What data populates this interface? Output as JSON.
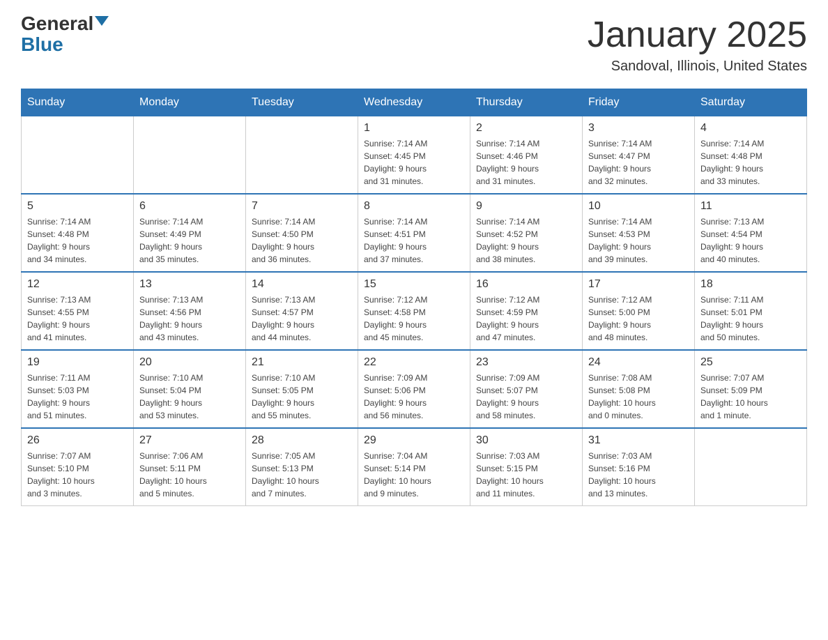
{
  "header": {
    "logo_general": "General",
    "logo_blue": "Blue",
    "title": "January 2025",
    "location": "Sandoval, Illinois, United States"
  },
  "days_of_week": [
    "Sunday",
    "Monday",
    "Tuesday",
    "Wednesday",
    "Thursday",
    "Friday",
    "Saturday"
  ],
  "weeks": [
    [
      {
        "day": "",
        "info": ""
      },
      {
        "day": "",
        "info": ""
      },
      {
        "day": "",
        "info": ""
      },
      {
        "day": "1",
        "info": "Sunrise: 7:14 AM\nSunset: 4:45 PM\nDaylight: 9 hours\nand 31 minutes."
      },
      {
        "day": "2",
        "info": "Sunrise: 7:14 AM\nSunset: 4:46 PM\nDaylight: 9 hours\nand 31 minutes."
      },
      {
        "day": "3",
        "info": "Sunrise: 7:14 AM\nSunset: 4:47 PM\nDaylight: 9 hours\nand 32 minutes."
      },
      {
        "day": "4",
        "info": "Sunrise: 7:14 AM\nSunset: 4:48 PM\nDaylight: 9 hours\nand 33 minutes."
      }
    ],
    [
      {
        "day": "5",
        "info": "Sunrise: 7:14 AM\nSunset: 4:48 PM\nDaylight: 9 hours\nand 34 minutes."
      },
      {
        "day": "6",
        "info": "Sunrise: 7:14 AM\nSunset: 4:49 PM\nDaylight: 9 hours\nand 35 minutes."
      },
      {
        "day": "7",
        "info": "Sunrise: 7:14 AM\nSunset: 4:50 PM\nDaylight: 9 hours\nand 36 minutes."
      },
      {
        "day": "8",
        "info": "Sunrise: 7:14 AM\nSunset: 4:51 PM\nDaylight: 9 hours\nand 37 minutes."
      },
      {
        "day": "9",
        "info": "Sunrise: 7:14 AM\nSunset: 4:52 PM\nDaylight: 9 hours\nand 38 minutes."
      },
      {
        "day": "10",
        "info": "Sunrise: 7:14 AM\nSunset: 4:53 PM\nDaylight: 9 hours\nand 39 minutes."
      },
      {
        "day": "11",
        "info": "Sunrise: 7:13 AM\nSunset: 4:54 PM\nDaylight: 9 hours\nand 40 minutes."
      }
    ],
    [
      {
        "day": "12",
        "info": "Sunrise: 7:13 AM\nSunset: 4:55 PM\nDaylight: 9 hours\nand 41 minutes."
      },
      {
        "day": "13",
        "info": "Sunrise: 7:13 AM\nSunset: 4:56 PM\nDaylight: 9 hours\nand 43 minutes."
      },
      {
        "day": "14",
        "info": "Sunrise: 7:13 AM\nSunset: 4:57 PM\nDaylight: 9 hours\nand 44 minutes."
      },
      {
        "day": "15",
        "info": "Sunrise: 7:12 AM\nSunset: 4:58 PM\nDaylight: 9 hours\nand 45 minutes."
      },
      {
        "day": "16",
        "info": "Sunrise: 7:12 AM\nSunset: 4:59 PM\nDaylight: 9 hours\nand 47 minutes."
      },
      {
        "day": "17",
        "info": "Sunrise: 7:12 AM\nSunset: 5:00 PM\nDaylight: 9 hours\nand 48 minutes."
      },
      {
        "day": "18",
        "info": "Sunrise: 7:11 AM\nSunset: 5:01 PM\nDaylight: 9 hours\nand 50 minutes."
      }
    ],
    [
      {
        "day": "19",
        "info": "Sunrise: 7:11 AM\nSunset: 5:03 PM\nDaylight: 9 hours\nand 51 minutes."
      },
      {
        "day": "20",
        "info": "Sunrise: 7:10 AM\nSunset: 5:04 PM\nDaylight: 9 hours\nand 53 minutes."
      },
      {
        "day": "21",
        "info": "Sunrise: 7:10 AM\nSunset: 5:05 PM\nDaylight: 9 hours\nand 55 minutes."
      },
      {
        "day": "22",
        "info": "Sunrise: 7:09 AM\nSunset: 5:06 PM\nDaylight: 9 hours\nand 56 minutes."
      },
      {
        "day": "23",
        "info": "Sunrise: 7:09 AM\nSunset: 5:07 PM\nDaylight: 9 hours\nand 58 minutes."
      },
      {
        "day": "24",
        "info": "Sunrise: 7:08 AM\nSunset: 5:08 PM\nDaylight: 10 hours\nand 0 minutes."
      },
      {
        "day": "25",
        "info": "Sunrise: 7:07 AM\nSunset: 5:09 PM\nDaylight: 10 hours\nand 1 minute."
      }
    ],
    [
      {
        "day": "26",
        "info": "Sunrise: 7:07 AM\nSunset: 5:10 PM\nDaylight: 10 hours\nand 3 minutes."
      },
      {
        "day": "27",
        "info": "Sunrise: 7:06 AM\nSunset: 5:11 PM\nDaylight: 10 hours\nand 5 minutes."
      },
      {
        "day": "28",
        "info": "Sunrise: 7:05 AM\nSunset: 5:13 PM\nDaylight: 10 hours\nand 7 minutes."
      },
      {
        "day": "29",
        "info": "Sunrise: 7:04 AM\nSunset: 5:14 PM\nDaylight: 10 hours\nand 9 minutes."
      },
      {
        "day": "30",
        "info": "Sunrise: 7:03 AM\nSunset: 5:15 PM\nDaylight: 10 hours\nand 11 minutes."
      },
      {
        "day": "31",
        "info": "Sunrise: 7:03 AM\nSunset: 5:16 PM\nDaylight: 10 hours\nand 13 minutes."
      },
      {
        "day": "",
        "info": ""
      }
    ]
  ]
}
